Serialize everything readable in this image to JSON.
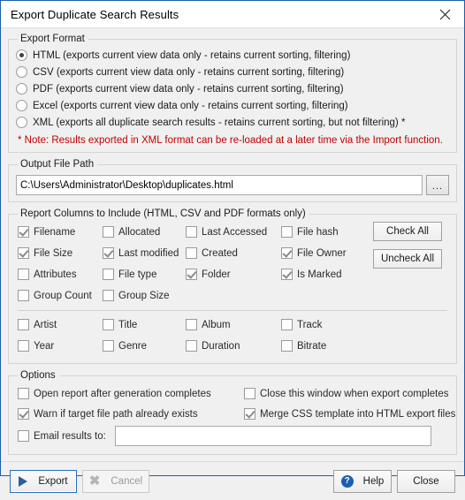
{
  "window": {
    "title": "Export Duplicate Search Results",
    "close_icon": "close-icon"
  },
  "export_format": {
    "legend": "Export Format",
    "options": [
      {
        "label": "HTML (exports current view data only - retains current sorting, filtering)",
        "selected": true
      },
      {
        "label": "CSV (exports current view data only - retains current sorting, filtering)",
        "selected": false
      },
      {
        "label": "PDF (exports current view data only - retains current sorting, filtering)",
        "selected": false
      },
      {
        "label": "Excel (exports current view data only - retains current sorting, filtering)",
        "selected": false
      },
      {
        "label": "XML (exports all duplicate search results - retains current sorting, but not filtering) *",
        "selected": false
      }
    ],
    "note": "* Note: Results exported in XML format can be re-loaded at a later time via the Import function.",
    "note_color": "#c00000"
  },
  "output_path": {
    "legend": "Output File Path",
    "value": "C:\\Users\\Administrator\\Desktop\\duplicates.html",
    "placeholder": "",
    "browse_label": "..."
  },
  "report_columns": {
    "legend": "Report Columns to Include (HTML, CSV and PDF formats only)",
    "rows": [
      [
        {
          "label": "Filename",
          "checked": true
        },
        {
          "label": "Allocated",
          "checked": false
        },
        {
          "label": "Last Accessed",
          "checked": false
        },
        {
          "label": "File hash",
          "checked": false
        }
      ],
      [
        {
          "label": "File Size",
          "checked": true
        },
        {
          "label": "Last modified",
          "checked": true
        },
        {
          "label": "Created",
          "checked": false
        },
        {
          "label": "File Owner",
          "checked": true
        }
      ],
      [
        {
          "label": "Attributes",
          "checked": false
        },
        {
          "label": "File type",
          "checked": false
        },
        {
          "label": "Folder",
          "checked": true
        },
        {
          "label": "Is Marked",
          "checked": true
        }
      ],
      [
        {
          "label": "Group Count",
          "checked": false
        },
        {
          "label": "Group Size",
          "checked": false
        }
      ]
    ],
    "media_rows": [
      [
        {
          "label": "Artist",
          "checked": false
        },
        {
          "label": "Title",
          "checked": false
        },
        {
          "label": "Album",
          "checked": false
        },
        {
          "label": "Track",
          "checked": false
        }
      ],
      [
        {
          "label": "Year",
          "checked": false
        },
        {
          "label": "Genre",
          "checked": false
        },
        {
          "label": "Duration",
          "checked": false
        },
        {
          "label": "Bitrate",
          "checked": false
        }
      ]
    ],
    "check_all_label": "Check All",
    "uncheck_all_label": "Uncheck All"
  },
  "options": {
    "legend": "Options",
    "rows": [
      [
        {
          "label": "Open report after generation completes",
          "checked": false
        },
        {
          "label": "Close this window when export completes",
          "checked": false
        }
      ],
      [
        {
          "label": "Warn if target file path already exists",
          "checked": true
        },
        {
          "label": "Merge CSS template into HTML export files",
          "checked": true
        }
      ]
    ],
    "email": {
      "label": "Email results to:",
      "checked": false,
      "value": "",
      "placeholder": ""
    }
  },
  "footer": {
    "export_label": "Export",
    "cancel_label": "Cancel",
    "help_label": "Help",
    "help_glyph": "?",
    "close_label": "Close",
    "accent_color": "#2a6bb5"
  }
}
